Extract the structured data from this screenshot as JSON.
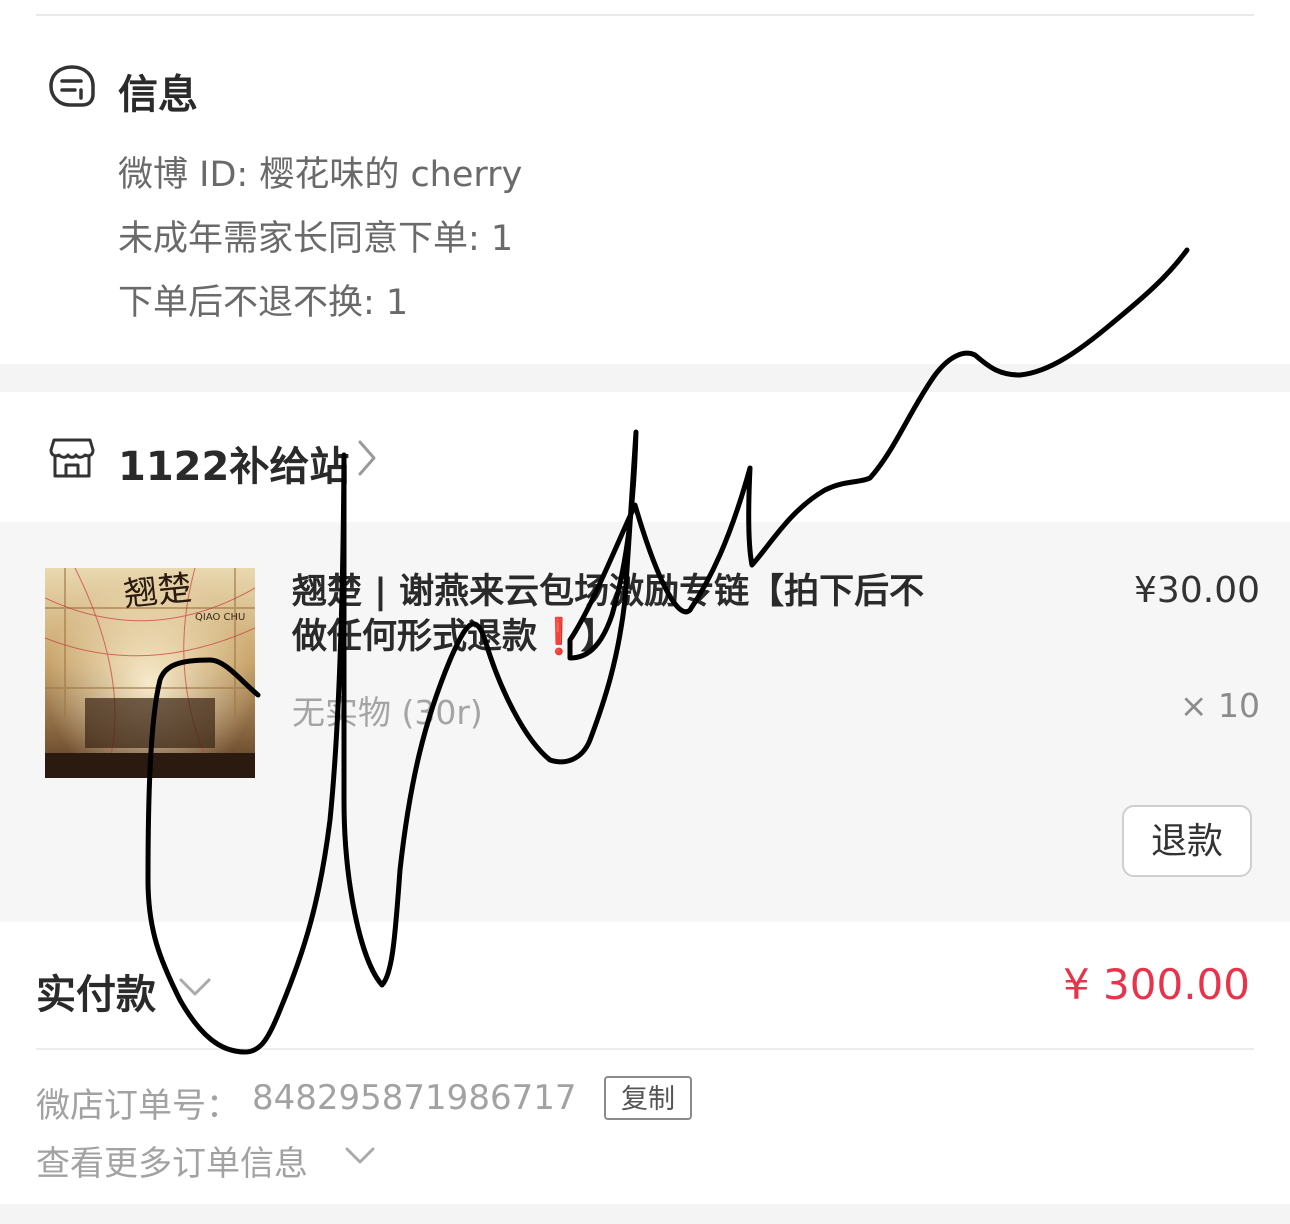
{
  "info": {
    "title": "信息",
    "lines": [
      "微博 ID: 樱花味的 cherry",
      "未成年需家长同意下单: 1",
      "下单后不退不换: 1"
    ]
  },
  "shop": {
    "name": "1122补给站"
  },
  "item": {
    "title": "翘楚 | 谢燕来云包场激励专链【拍下后不做任何形式退款❗️】",
    "price": "¥30.00",
    "spec": "无实物 (30r)",
    "quantity": "× 10",
    "refund_label": "退款",
    "thumbnail_text": "翘楚",
    "thumbnail_subtext": "QIAO CHU"
  },
  "payment": {
    "label": "实付款",
    "amount": "¥ 300.00"
  },
  "order": {
    "number_label": "微店订单号：",
    "number": "848295871986717",
    "copy_label": "复制",
    "more_label": "查看更多订单信息"
  },
  "colors": {
    "accent_price": "#e8334a",
    "text_primary": "#2a2a2a",
    "text_muted": "#a2a2a2",
    "panel_bg": "#f6f6f6"
  },
  "icons": {
    "info": "chat-bubble-icon",
    "shop": "storefront-icon"
  }
}
